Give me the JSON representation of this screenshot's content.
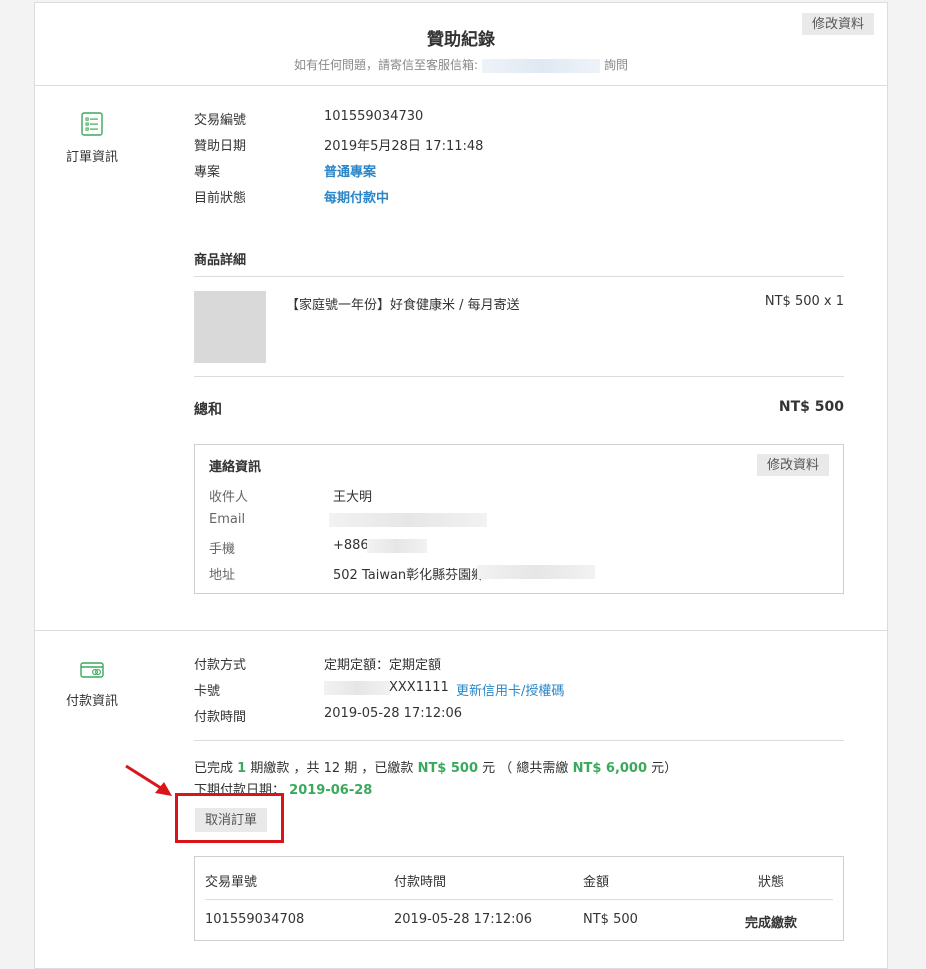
{
  "header": {
    "title": "贊助紀錄",
    "subtitle_prefix": "如有任何問題，請寄信至客服信箱:",
    "subtitle_suffix": "詢問",
    "edit_button": "修改資料"
  },
  "order_section": {
    "label": "訂單資訊",
    "icon": "list-icon",
    "rows": [
      {
        "label": "交易編號",
        "value": "101559034730"
      },
      {
        "label": "贊助日期",
        "value": "2019年5月28日 17:11:48"
      },
      {
        "label": "專案",
        "value": "普通專案"
      },
      {
        "label": "目前狀態",
        "value": "每期付款中"
      }
    ],
    "product_details_title": "商品詳細",
    "product": {
      "name": "【家庭號一年份】好食健康米 / 每月寄送",
      "price": "NT$ 500 x 1"
    },
    "total_label": "總和",
    "total_value": "NT$ 500"
  },
  "contact": {
    "title": "連絡資訊",
    "edit_button": "修改資料",
    "rows": [
      {
        "label": "收件人",
        "value": "王大明"
      },
      {
        "label": "Email",
        "value": ""
      },
      {
        "label": "手機",
        "value": "+886"
      },
      {
        "label": "地址",
        "value": "502 Taiwan彰化縣芬園鄉"
      }
    ]
  },
  "payment_section": {
    "label": "付款資訊",
    "icon": "credit-card-icon",
    "method_label": "付款方式",
    "method_value": "定期定額：定期定額",
    "card_label": "卡號",
    "card_value": "XXX1111",
    "card_link": "更新信用卡/授權碼",
    "time_label": "付款時間",
    "time_value": "2019-05-28 17:12:06",
    "summary": {
      "p1": "已完成",
      "done": "1",
      "p2": "期繳款 ，共 12 期 ，已繳款",
      "paid": "NT$ 500",
      "p3": "元 （ 總共需繳",
      "total": "NT$ 6,000",
      "p4": "元）"
    },
    "next_label": "下期付款日期：",
    "next_date": "2019-06-28",
    "cancel_button": "取消訂單",
    "table": {
      "headers": [
        "交易單號",
        "付款時間",
        "金額",
        "狀態"
      ],
      "rows": [
        {
          "id": "101559034708",
          "time": "2019-05-28 17:12:06",
          "amount": "NT$ 500",
          "status": "完成繳款"
        }
      ]
    }
  },
  "colors": {
    "accent_green": "#3aa95c",
    "link_blue": "#2a86c8",
    "highlight_red": "#d9141b"
  }
}
